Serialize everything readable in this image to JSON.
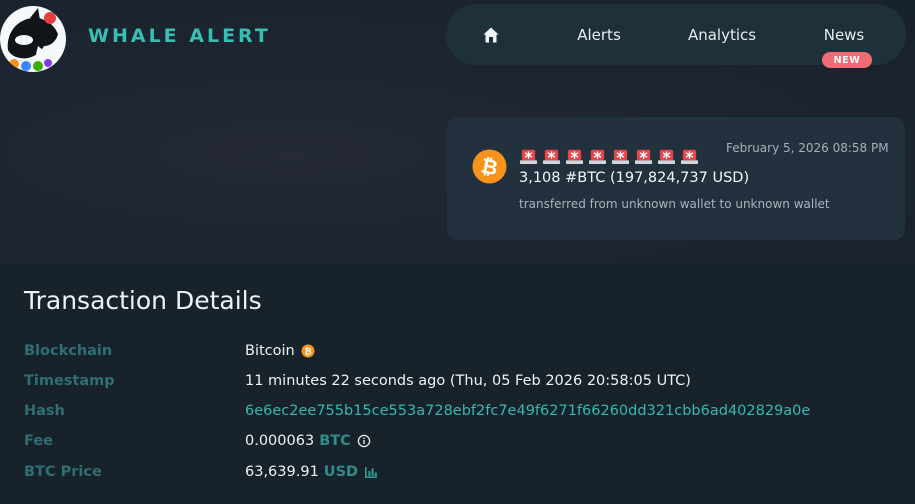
{
  "brand": {
    "name": "WHALE ALERT",
    "logo_icon": "orca-whale-logo"
  },
  "nav": {
    "home_icon": "home-icon",
    "items": [
      {
        "label": "Alerts"
      },
      {
        "label": "Analytics"
      },
      {
        "label": "News",
        "badge": "NEW"
      }
    ]
  },
  "alert_card": {
    "coin_icon": "bitcoin-icon",
    "siren_count": 8,
    "siren_icon": "siren-icon",
    "date": "February 5, 2026 08:58 PM",
    "amount": "3,108 #BTC (197,824,737 USD)",
    "description": "transferred from unknown wallet to unknown wallet"
  },
  "details": {
    "title": "Transaction Details",
    "rows": [
      {
        "label": "Blockchain",
        "value": "Bitcoin"
      },
      {
        "label": "Timestamp",
        "value": "11 minutes 22 seconds ago (Thu, 05 Feb 2026 20:58:05 UTC)"
      },
      {
        "label": "Hash",
        "value": "6e6ec2ee755b15ce553a728ebf2fc7e49f6271f66260dd321cbb6ad402829a0e"
      },
      {
        "label": "Fee",
        "value": "0.000063",
        "unit": "BTC"
      },
      {
        "label": "BTC Price",
        "value": "63,639.91",
        "unit": "USD"
      }
    ]
  },
  "colors": {
    "accent_teal": "#36c0b4",
    "label_teal": "#2f6f74",
    "badge_red": "#f06b73",
    "bitcoin_orange": "#f7931a"
  }
}
